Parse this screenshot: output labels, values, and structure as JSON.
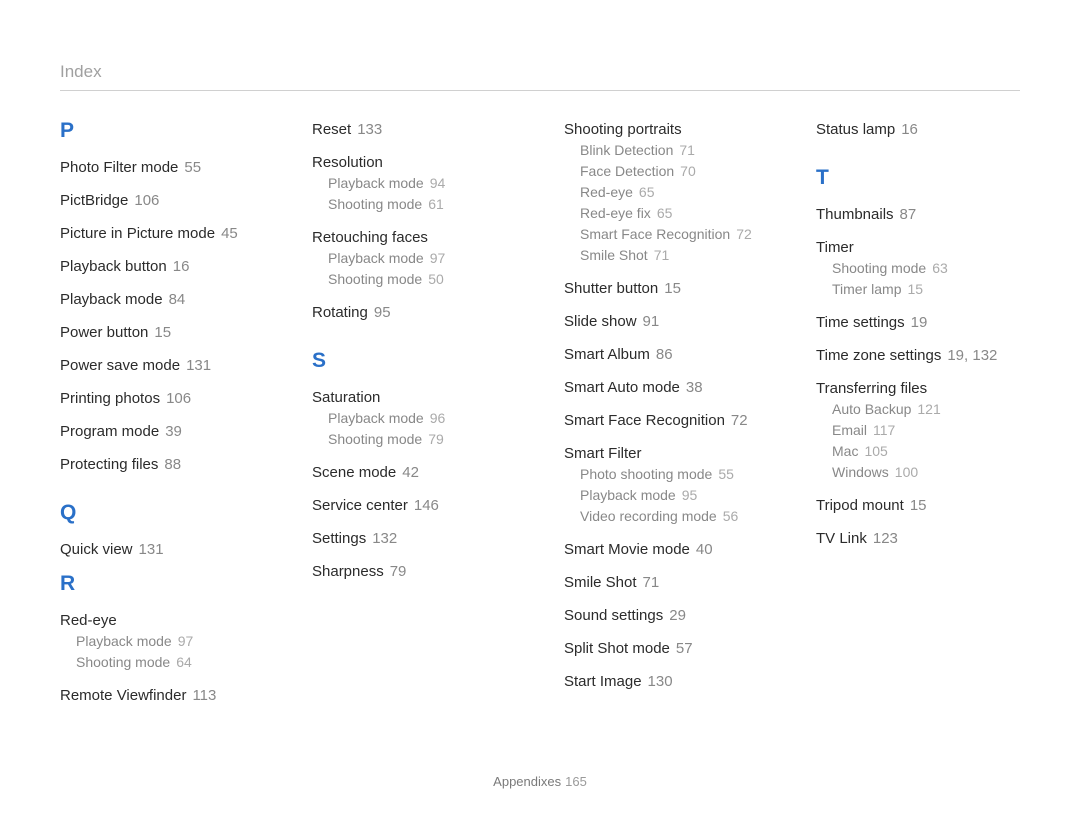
{
  "header": "Index",
  "footer_label": "Appendixes",
  "footer_page": "165",
  "sections": [
    {
      "letter": "P",
      "padTop": false,
      "entries": [
        {
          "label": "Photo Filter mode",
          "page": "55"
        },
        {
          "label": "PictBridge",
          "page": "106"
        },
        {
          "label": "Picture in Picture mode",
          "page": "45"
        },
        {
          "label": "Playback button",
          "page": "16"
        },
        {
          "label": "Playback mode",
          "page": "84"
        },
        {
          "label": "Power button",
          "page": "15"
        },
        {
          "label": "Power save mode",
          "page": "131"
        },
        {
          "label": "Printing photos",
          "page": "106"
        },
        {
          "label": "Program mode",
          "page": "39"
        },
        {
          "label": "Protecting files",
          "page": "88"
        }
      ]
    },
    {
      "letter": "Q",
      "padTop": true,
      "entries": [
        {
          "label": "Quick view",
          "page": "131"
        }
      ]
    },
    {
      "letter": "R",
      "padTop": false,
      "entries": [
        {
          "label": "Red-eye",
          "subs": [
            {
              "label": "Playback mode",
              "page": "97"
            },
            {
              "label": "Shooting mode",
              "page": "64"
            }
          ]
        },
        {
          "label": "Remote Viewfinder",
          "page": "113"
        },
        {
          "label": "Reset",
          "page": "133"
        },
        {
          "label": "Resolution",
          "subs": [
            {
              "label": "Playback mode",
              "page": "94"
            },
            {
              "label": "Shooting mode",
              "page": "61"
            }
          ]
        },
        {
          "label": "Retouching faces",
          "subs": [
            {
              "label": "Playback mode",
              "page": "97"
            },
            {
              "label": "Shooting mode",
              "page": "50"
            }
          ]
        },
        {
          "label": "Rotating",
          "page": "95"
        }
      ]
    },
    {
      "letter": "S",
      "padTop": true,
      "entries": [
        {
          "label": "Saturation",
          "subs": [
            {
              "label": "Playback mode",
              "page": "96"
            },
            {
              "label": "Shooting mode",
              "page": "79"
            }
          ]
        },
        {
          "label": "Scene mode",
          "page": "42"
        },
        {
          "label": "Service center",
          "page": "146"
        },
        {
          "label": "Settings",
          "page": "132"
        },
        {
          "label": "Sharpness",
          "page": "79"
        },
        {
          "label": "Shooting portraits",
          "subs": [
            {
              "label": "Blink Detection",
              "page": "71"
            },
            {
              "label": "Face Detection",
              "page": "70"
            },
            {
              "label": "Red-eye",
              "page": "65"
            },
            {
              "label": "Red-eye fix",
              "page": "65"
            },
            {
              "label": "Smart Face Recognition",
              "page": "72"
            },
            {
              "label": "Smile Shot",
              "page": "71"
            }
          ]
        },
        {
          "label": "Shutter button",
          "page": "15"
        },
        {
          "label": "Slide show",
          "page": "91"
        },
        {
          "label": "Smart Album",
          "page": "86"
        },
        {
          "label": "Smart Auto mode",
          "page": "38"
        },
        {
          "label": "Smart Face Recognition",
          "page": "72"
        },
        {
          "label": "Smart Filter",
          "subs": [
            {
              "label": "Photo shooting mode",
              "page": "55"
            },
            {
              "label": "Playback mode",
              "page": "95"
            },
            {
              "label": "Video recording mode",
              "page": "56"
            }
          ]
        },
        {
          "label": "Smart Movie mode",
          "page": "40"
        },
        {
          "label": "Smile Shot",
          "page": "71"
        },
        {
          "label": "Sound settings",
          "page": "29"
        },
        {
          "label": "Split Shot mode",
          "page": "57"
        },
        {
          "label": "Start Image",
          "page": "130"
        },
        {
          "label": "Status lamp",
          "page": "16"
        }
      ]
    },
    {
      "letter": "T",
      "padTop": true,
      "entries": [
        {
          "label": "Thumbnails",
          "page": "87"
        },
        {
          "label": "Timer",
          "subs": [
            {
              "label": "Shooting mode",
              "page": "63"
            },
            {
              "label": "Timer lamp",
              "page": "15"
            }
          ]
        },
        {
          "label": "Time settings",
          "page": "19"
        },
        {
          "label": "Time zone settings",
          "page": "19, 132"
        },
        {
          "label": "Transferring files",
          "subs": [
            {
              "label": "Auto Backup",
              "page": "121"
            },
            {
              "label": "Email",
              "page": "117"
            },
            {
              "label": "Mac",
              "page": "105"
            },
            {
              "label": "Windows",
              "page": "100"
            }
          ]
        },
        {
          "label": "Tripod mount",
          "page": "15"
        },
        {
          "label": "TV Link",
          "page": "123"
        }
      ]
    }
  ]
}
